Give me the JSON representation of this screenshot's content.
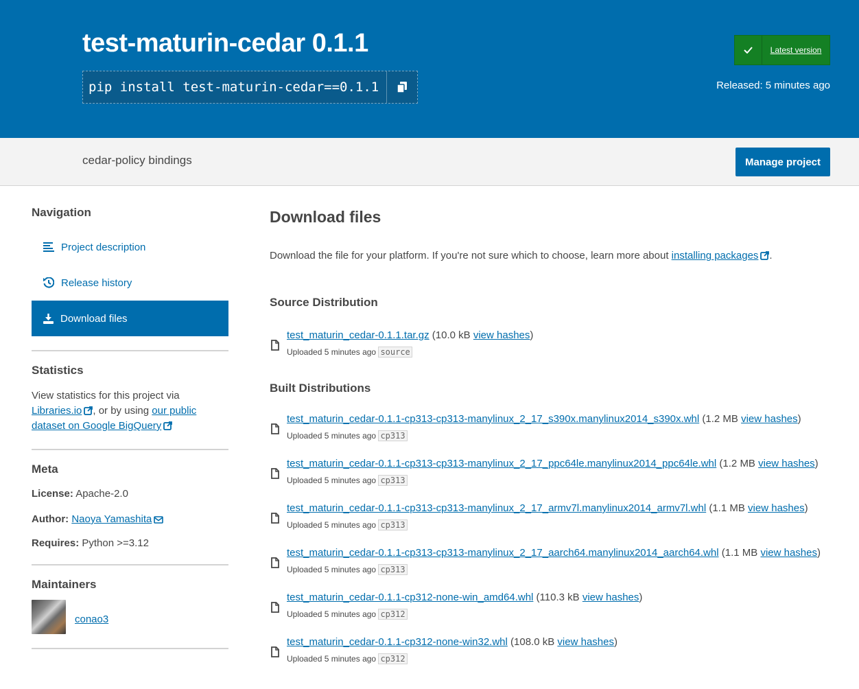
{
  "header": {
    "title": "test-maturin-cedar 0.1.1",
    "pip_command": "pip install test-maturin-cedar==0.1.1",
    "badge_label": "Latest version",
    "released": "Released: 5 minutes ago"
  },
  "subbar": {
    "summary": "cedar-policy bindings",
    "manage_label": "Manage project"
  },
  "sidebar": {
    "navigation_heading": "Navigation",
    "nav_items": [
      {
        "label": "Project description",
        "icon": "align-left-icon"
      },
      {
        "label": "Release history",
        "icon": "history-icon"
      },
      {
        "label": "Download files",
        "icon": "download-icon"
      }
    ],
    "statistics_heading": "Statistics",
    "stats_text_1": "View statistics for this project via",
    "stats_link_1": "Libraries.io",
    "stats_text_2": ", or by using",
    "stats_link_2a": "our public",
    "stats_link_2b": "dataset on Google BigQuery",
    "meta_heading": "Meta",
    "license_label": "License:",
    "license_value": "Apache-2.0",
    "author_label": "Author:",
    "author_value": "Naoya Yamashita",
    "requires_label": "Requires:",
    "requires_value": "Python >=3.12",
    "maintainers_heading": "Maintainers",
    "maintainer": "conao3"
  },
  "main": {
    "heading": "Download files",
    "intro": "Download the file for your platform. If you're not sure which to choose, learn more about",
    "intro_link": "installing packages",
    "intro_end": ".",
    "source_heading": "Source Distribution",
    "built_heading": "Built Distributions",
    "view_hashes": "view hashes",
    "uploaded": "Uploaded 5 minutes ago",
    "source_files": [
      {
        "name": "test_maturin_cedar-0.1.1.tar.gz",
        "size": "10.0 kB",
        "tag": "source"
      }
    ],
    "built_files": [
      {
        "name": "test_maturin_cedar-0.1.1-cp313-cp313-manylinux_2_17_s390x.manylinux2014_s390x.whl",
        "size": "1.2 MB",
        "tag": "cp313"
      },
      {
        "name": "test_maturin_cedar-0.1.1-cp313-cp313-manylinux_2_17_ppc64le.manylinux2014_ppc64le.whl",
        "size": "1.2 MB",
        "tag": "cp313"
      },
      {
        "name": "test_maturin_cedar-0.1.1-cp313-cp313-manylinux_2_17_armv7l.manylinux2014_armv7l.whl",
        "size": "1.1 MB",
        "tag": "cp313"
      },
      {
        "name": "test_maturin_cedar-0.1.1-cp313-cp313-manylinux_2_17_aarch64.manylinux2014_aarch64.whl",
        "size": "1.1 MB",
        "tag": "cp313"
      },
      {
        "name": "test_maturin_cedar-0.1.1-cp312-none-win_amd64.whl",
        "size": "110.3 kB",
        "tag": "cp312"
      },
      {
        "name": "test_maturin_cedar-0.1.1-cp312-none-win32.whl",
        "size": "108.0 kB",
        "tag": "cp312"
      }
    ]
  }
}
